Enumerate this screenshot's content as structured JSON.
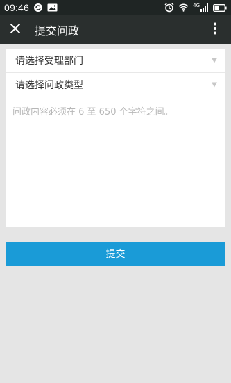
{
  "status_bar": {
    "time": "09:46",
    "icons_left": [
      "sync-icon",
      "image-icon"
    ],
    "icons_right": [
      "alarm-icon",
      "wifi-icon",
      "signal-4g-icon",
      "battery-icon"
    ],
    "network_label": "4G"
  },
  "app_bar": {
    "title": "提交问政",
    "close_icon": "close-icon",
    "more_icon": "more-vert-icon"
  },
  "form": {
    "department_select": {
      "selected": "请选择受理部门"
    },
    "type_select": {
      "selected": "请选择问政类型"
    },
    "content": {
      "value": "",
      "placeholder": "问政内容必须在 6 至 650 个字符之间。"
    }
  },
  "submit_label": "提交",
  "colors": {
    "status_bar_bg": "#1f2524",
    "app_bar_bg": "#2a2f2e",
    "page_bg": "#e5e5e5",
    "accent": "#1a9bd7"
  }
}
